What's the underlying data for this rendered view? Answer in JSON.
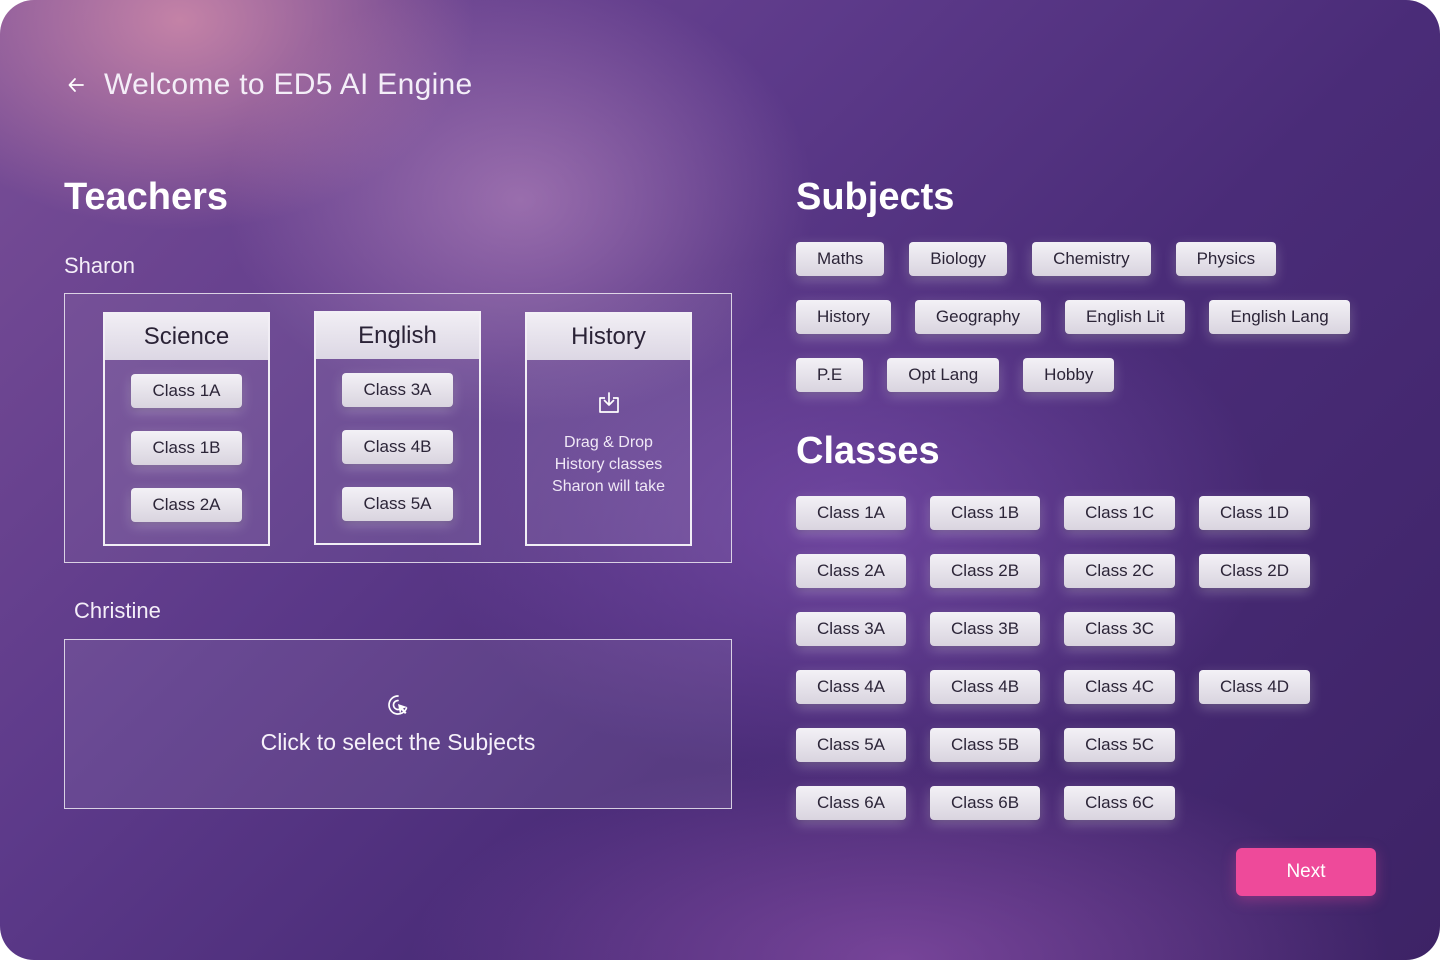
{
  "header": {
    "title": "Welcome to ED5 AI Engine"
  },
  "teachers": {
    "title": "Teachers",
    "sharon": {
      "name": "Sharon",
      "cards": [
        {
          "subject": "Science",
          "classes": [
            "Class 1A",
            "Class 1B",
            "Class 2A"
          ]
        },
        {
          "subject": "English",
          "classes": [
            "Class 3A",
            "Class 4B",
            "Class 5A"
          ]
        },
        {
          "subject": "History",
          "drop_text": "Drag & Drop History classes Sharon will take"
        }
      ]
    },
    "christine": {
      "name": "Christine",
      "select_text": "Click to select the Subjects"
    }
  },
  "subjects": {
    "title": "Subjects",
    "rows": [
      [
        "Maths",
        "Biology",
        "Chemistry",
        "Physics"
      ],
      [
        "History",
        "Geography",
        "English Lit",
        "English Lang"
      ],
      [
        "P.E",
        "Opt Lang",
        "Hobby"
      ]
    ]
  },
  "classes": {
    "title": "Classes",
    "rows": [
      [
        "Class 1A",
        "Class 1B",
        "Class 1C",
        "Class 1D"
      ],
      [
        "Class 2A",
        "Class 2B",
        "Class 2C",
        "Class 2D"
      ],
      [
        "Class 3A",
        "Class 3B",
        "Class 3C"
      ],
      [
        "Class 4A",
        "Class 4B",
        "Class 4C",
        "Class 4D"
      ],
      [
        "Class 5A",
        "Class 5B",
        "Class 5C"
      ],
      [
        "Class 6A",
        "Class 6B",
        "Class 6C"
      ]
    ]
  },
  "actions": {
    "next_label": "Next"
  },
  "colors": {
    "accent": "#ee4a9a",
    "chip": "#e6e2ea",
    "text_light": "#ffffff"
  }
}
